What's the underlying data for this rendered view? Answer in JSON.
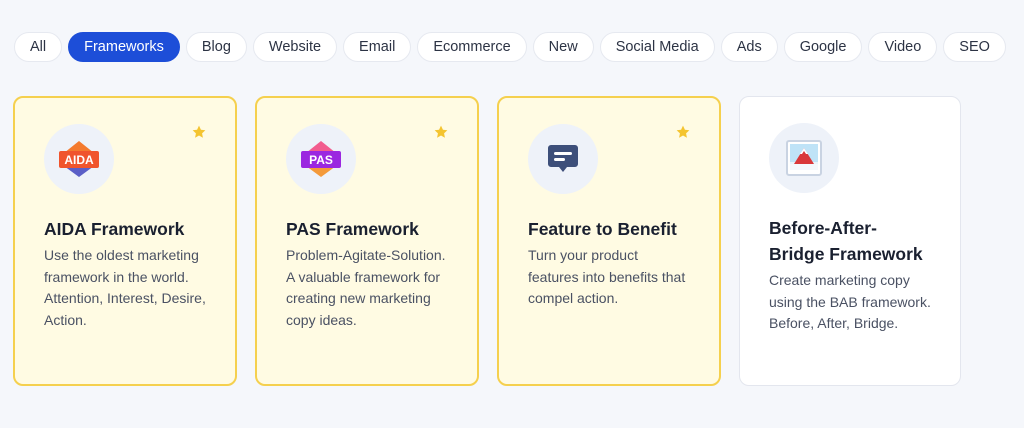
{
  "filters": [
    {
      "label": "All",
      "active": false
    },
    {
      "label": "Frameworks",
      "active": true
    },
    {
      "label": "Blog",
      "active": false
    },
    {
      "label": "Website",
      "active": false
    },
    {
      "label": "Email",
      "active": false
    },
    {
      "label": "Ecommerce",
      "active": false
    },
    {
      "label": "New",
      "active": false
    },
    {
      "label": "Social Media",
      "active": false
    },
    {
      "label": "Ads",
      "active": false
    },
    {
      "label": "Google",
      "active": false
    },
    {
      "label": "Video",
      "active": false
    },
    {
      "label": "SEO",
      "active": false
    }
  ],
  "cards": [
    {
      "title": "AIDA Framework",
      "description": "Use the oldest marketing framework in the world. Attention, Interest, Desire, Action.",
      "icon": "aida-logo-icon",
      "icon_text": "AIDA",
      "favorite": true
    },
    {
      "title": "PAS Framework",
      "description": "Problem-Agitate-Solution. A valuable framework for creating new marketing copy ideas.",
      "icon": "pas-logo-icon",
      "icon_text": "PAS",
      "favorite": true
    },
    {
      "title": "Feature to Benefit",
      "description": "Turn your product features into benefits that compel action.",
      "icon": "message-icon",
      "favorite": true
    },
    {
      "title": "Before-After-Bridge Framework",
      "description": "Create marketing copy using the BAB framework. Before, After, Bridge.",
      "icon": "picture-icon",
      "favorite": false
    }
  ],
  "colors": {
    "accent": "#1d4ed8",
    "favorite_card_bg": "#fffbe3",
    "favorite_card_border": "#f5d04e",
    "star": "#f4c430"
  }
}
